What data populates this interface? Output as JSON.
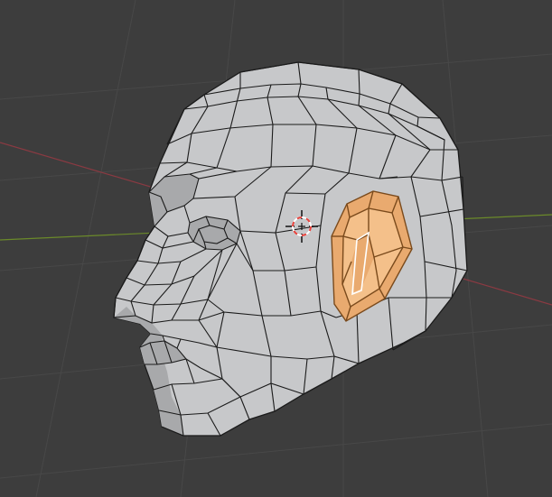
{
  "viewport": {
    "background_color": "#3d3d3d",
    "grid_line_color": "#484848",
    "x_axis_color": "#8a3a42",
    "y_axis_color": "#6b8a2a"
  },
  "mesh": {
    "object": "head",
    "face_color": "#c7c8ca",
    "face_shadow_color": "#a8a9ab",
    "edge_color": "#1b1b1b",
    "selection": {
      "part": "ear",
      "fill_color": "#e9aa6f",
      "fill_light_color": "#f4c08a",
      "edge_color": "#7a4a1c",
      "active_edge_color": "#ffffff"
    }
  },
  "cursor_3d": {
    "icon": "3d-cursor-icon",
    "ring_color_a": "#e8413c",
    "ring_color_b": "#ffffff",
    "crosshair_color": "#111111"
  }
}
